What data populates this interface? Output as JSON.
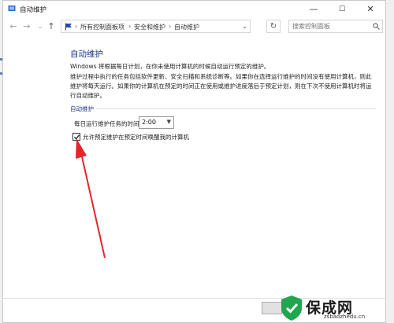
{
  "window": {
    "title": "自动维护",
    "controls": {
      "minimize": "—",
      "maximize": "☐",
      "close": "✕"
    }
  },
  "nav": {
    "back": "←",
    "forward": "→",
    "recent": "⌄",
    "up": "↑",
    "breadcrumbs": [
      "所有控制面板项",
      "安全和维护",
      "自动维护"
    ],
    "refresh": "↻",
    "search_placeholder": "搜索控制面板"
  },
  "main": {
    "heading": "自动维护",
    "intro": "Windows 将根据每日计划，在你未使用计算机的时候自动运行预定的维护。",
    "description": "维护过程中执行的任务包括软件更新、安全扫描和系统诊断等。如果你在选择运行维护的时间没有使用计算机，则此维护将每天运行。如果你的计算机在预定的时间正在使用或维护进度落后于预定计划，则在下次不使用计算机时将运行自动维护。",
    "section_title": "自动维护",
    "time_label": "每日运行维护任务的时间",
    "time_value": "2:00",
    "wake_label": "允许预定维护在预定时间唤醒我的计算机",
    "wake_checked": true
  },
  "watermark": {
    "logo_text": "保成网",
    "url": "zsbaozhedu.cn"
  },
  "colors": {
    "heading": "#1e3287",
    "annotation_arrow": "#e3262b",
    "logo_green": "#22a54f"
  }
}
